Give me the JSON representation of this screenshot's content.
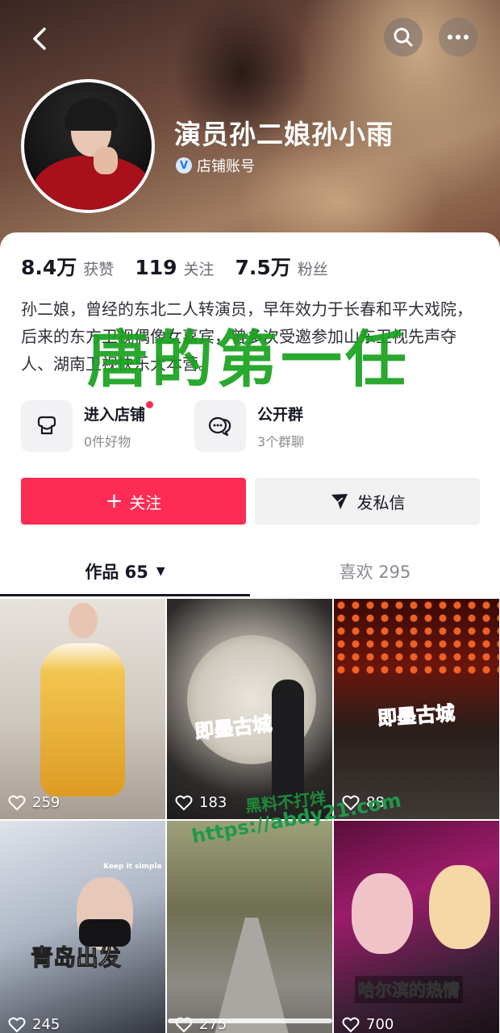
{
  "header": {
    "back_icon": "back-arrow-icon",
    "search_icon": "search-icon",
    "more_icon": "more-dots-icon",
    "name": "演员孙二娘孙小雨",
    "badge": "店铺账号",
    "badge_icon": "verified-v-icon"
  },
  "stats": [
    {
      "num": "8.4万",
      "label": "获赞"
    },
    {
      "num": "119",
      "label": "关注"
    },
    {
      "num": "7.5万",
      "label": "粉丝"
    }
  ],
  "bio": "孙二娘，曾经的东北二人转演员，早年效力于长春和平大戏院，后来的东方卫视偶像女嘉宾，曾多次受邀参加山东卫视先声夺人、湖南卫视快乐大本营。",
  "shortcuts": {
    "store": {
      "title": "进入店铺",
      "sub": "0件好物",
      "icon": "store-icon"
    },
    "group": {
      "title": "公开群",
      "sub": "3个群聊",
      "icon": "group-chat-icon"
    }
  },
  "actions": {
    "follow": "关注",
    "message": "发私信"
  },
  "tabs": {
    "works": "作品 65",
    "likes": "喜欢 295"
  },
  "videos": [
    {
      "likes": "259",
      "caption": ""
    },
    {
      "likes": "183",
      "caption": "即墨古城"
    },
    {
      "likes": "88",
      "caption": "即墨古城"
    },
    {
      "likes": "245",
      "caption": "青岛出发"
    },
    {
      "likes": "275",
      "caption": ""
    },
    {
      "likes": "700",
      "caption": "哈尔滨的热情"
    }
  ],
  "video_small_text": "Keep it simple",
  "overlays": {
    "big_text": "唐的第一任",
    "watermark_1": "黑料不打烊",
    "watermark_2": "https://abdy21.com"
  },
  "colors": {
    "accent": "#fe2c55",
    "overlay_green": "#19a11e"
  }
}
